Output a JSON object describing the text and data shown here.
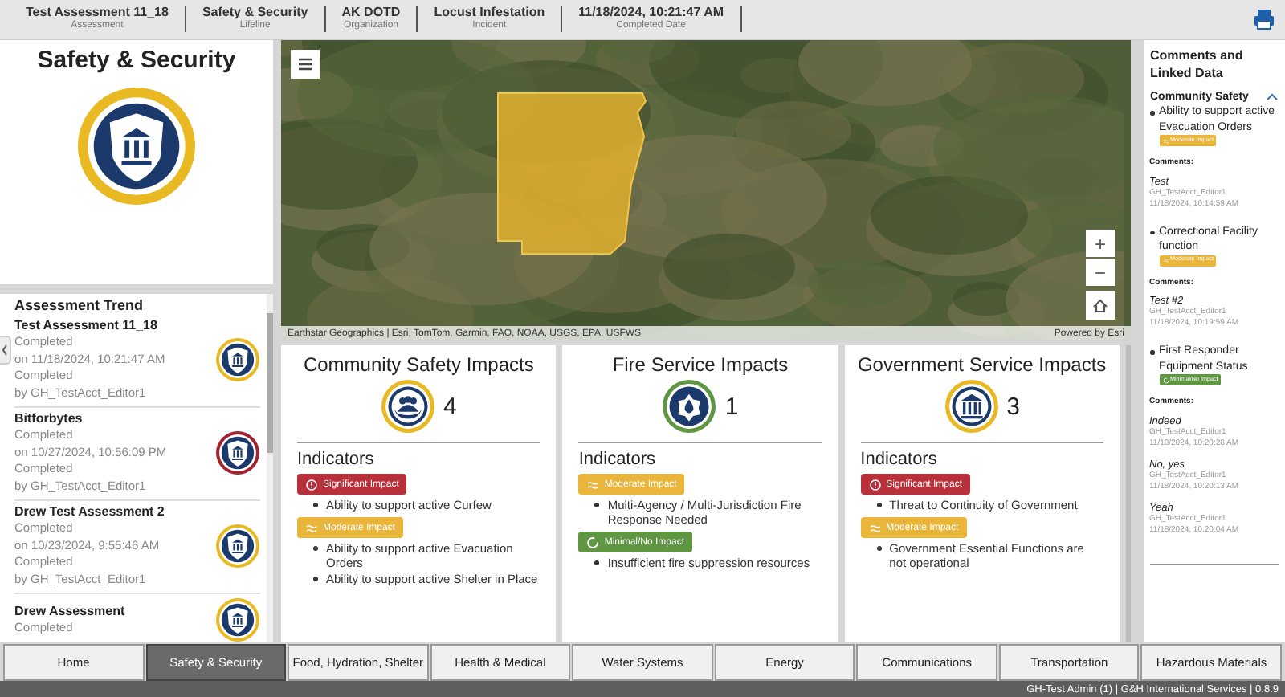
{
  "header": {
    "fields": [
      {
        "value": "Test Assessment 11_18",
        "label": "Assessment"
      },
      {
        "value": "Safety & Security",
        "label": "Lifeline"
      },
      {
        "value": "AK DOTD",
        "label": "Organization"
      },
      {
        "value": "Locust Infestation",
        "label": "Incident"
      },
      {
        "value": "11/18/2024, 10:21:47 AM",
        "label": "Completed Date"
      }
    ]
  },
  "lifeline_card": {
    "title": "Safety & Security"
  },
  "assessment_trend": {
    "title": "Assessment Trend",
    "items": [
      {
        "name": "Test Assessment 11_18",
        "lines": [
          "Completed",
          "on 11/18/2024, 10:21:47 AM",
          "Completed",
          "by GH_TestAcct_Editor1"
        ],
        "color": "#e8b923"
      },
      {
        "name": "Bitforbytes",
        "lines": [
          "Completed",
          "on 10/27/2024, 10:56:09 PM",
          "Completed",
          "by GH_TestAcct_Editor1"
        ],
        "color": "#a3242f"
      },
      {
        "name": "Drew Test Assessment 2",
        "lines": [
          "Completed",
          "on 10/23/2024, 9:55:46 AM",
          "Completed",
          "by GH_TestAcct_Editor1"
        ],
        "color": "#e8b923"
      },
      {
        "name": "Drew Assessment",
        "lines": [
          "Completed"
        ],
        "color": "#e8b923"
      }
    ]
  },
  "map": {
    "attribution": "Earthstar Geographics | Esri, TomTom, Garmin, FAO, NOAA, USGS, EPA, USFWS",
    "powered_by": "Powered by Esri",
    "zoom_in": "+",
    "zoom_out": "−"
  },
  "impact_cards": [
    {
      "title": "Community Safety Impacts",
      "count": "4",
      "color": "#e8b923",
      "indicators_title": "Indicators",
      "groups": [
        {
          "kind": "significant",
          "label": "Significant Impact",
          "items": [
            "Ability to support active Curfew"
          ]
        },
        {
          "kind": "moderate",
          "label": "Moderate Impact",
          "items": [
            "Ability to support active Evacuation Orders",
            "Ability to support active Shelter in Place"
          ]
        }
      ]
    },
    {
      "title": "Fire Service Impacts",
      "count": "1",
      "color": "#5e9641",
      "indicators_title": "Indicators",
      "groups": [
        {
          "kind": "moderate",
          "label": "Moderate Impact",
          "items": [
            "Multi-Agency / Multi-Jurisdiction Fire Response Needed"
          ]
        },
        {
          "kind": "minimal",
          "label": "Minimal/No Impact",
          "items": [
            "Insufficient fire suppression resources"
          ]
        }
      ]
    },
    {
      "title": "Government Service Impacts",
      "count": "3",
      "color": "#e8b923",
      "indicators_title": "Indicators",
      "groups": [
        {
          "kind": "significant",
          "label": "Significant Impact",
          "items": [
            "Threat to Continuity of Government"
          ]
        },
        {
          "kind": "moderate",
          "label": "Moderate Impact",
          "items": [
            "Government Essential Functions are not operational"
          ]
        }
      ]
    }
  ],
  "comments_panel": {
    "title": "Comments and Linked Data",
    "section": {
      "title": "Community Safety",
      "expanded": true,
      "items": [
        {
          "text": "Ability to support active Evacuation Orders",
          "kind": "moderate",
          "badge": "Moderate Impact",
          "comments_label": "Comments:",
          "comments": [
            {
              "text": "Test",
              "author": "GH_TestAcct_Editor1",
              "date": "11/18/2024, 10:14:59 AM"
            }
          ]
        },
        {
          "text": "Correctional Facility function",
          "kind": "moderate",
          "badge": "Moderate Impact",
          "comments_label": "Comments:",
          "comments": [
            {
              "text": "Test #2",
              "author": "GH_TestAcct_Editor1",
              "date": "11/18/2024, 10:19:59 AM"
            }
          ]
        },
        {
          "text": "First Responder Equipment Status",
          "kind": "minimal",
          "badge": "Minimal/No Impact",
          "comments_label": "Comments:",
          "comments": [
            {
              "text": "Indeed",
              "author": "GH_TestAcct_Editor1",
              "date": "11/18/2024, 10:20:28 AM"
            },
            {
              "text": "No, yes",
              "author": "GH_TestAcct_Editor1",
              "date": "11/18/2024, 10:20:13 AM"
            },
            {
              "text": "Yeah",
              "author": "GH_TestAcct_Editor1",
              "date": "11/18/2024, 10:20:04 AM"
            }
          ]
        }
      ]
    }
  },
  "tabs": [
    {
      "label": "Home",
      "selected": false
    },
    {
      "label": "Safety & Security",
      "selected": true
    },
    {
      "label": "Food, Hydration, Shelter",
      "selected": false
    },
    {
      "label": "Health & Medical",
      "selected": false
    },
    {
      "label": "Water Systems",
      "selected": false
    },
    {
      "label": "Energy",
      "selected": false
    },
    {
      "label": "Communications",
      "selected": false
    },
    {
      "label": "Transportation",
      "selected": false
    },
    {
      "label": "Hazardous Materials",
      "selected": false
    }
  ],
  "status_bar": {
    "text": "GH-Test Admin (1) | G&H International Services | 0.8.9"
  }
}
